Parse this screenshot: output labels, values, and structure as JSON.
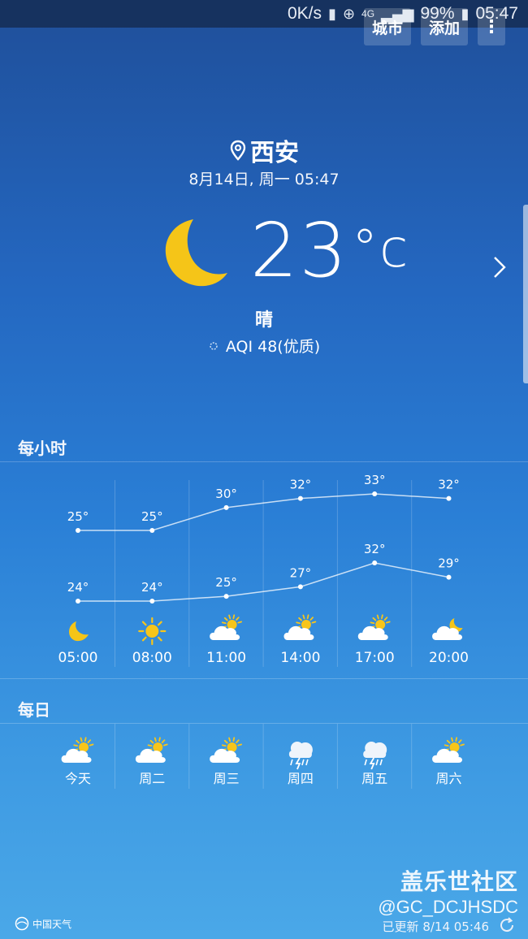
{
  "status_bar": {
    "net_speed": "0K/s",
    "network_type": "4G",
    "battery": "99%",
    "time": "05:47"
  },
  "actions": {
    "city_label": "城市",
    "add_label": "添加",
    "more_label": "⋮"
  },
  "current": {
    "city": "西安",
    "datetime": "8月14日, 周一 05:47",
    "temperature": "23",
    "unit": "°c",
    "condition": "晴",
    "aqi": "AQI 48(优质)",
    "icon": "moon-icon"
  },
  "hourly": {
    "title": "每小时",
    "items": [
      {
        "time": "05:00",
        "high": "25°",
        "low": "24°",
        "icon": "moon-icon"
      },
      {
        "time": "08:00",
        "high": "25°",
        "low": "24°",
        "icon": "sun-icon"
      },
      {
        "time": "11:00",
        "high": "30°",
        "low": "25°",
        "icon": "partly-cloudy-icon"
      },
      {
        "time": "14:00",
        "high": "32°",
        "low": "27°",
        "icon": "partly-cloudy-icon"
      },
      {
        "time": "17:00",
        "high": "33°",
        "low": "32°",
        "icon": "partly-cloudy-icon"
      },
      {
        "time": "20:00",
        "high": "32°",
        "low": "29°",
        "icon": "partly-cloudy-night-icon"
      }
    ],
    "high_values": [
      25,
      25,
      30,
      32,
      33,
      32
    ],
    "low_values": [
      24,
      24,
      25,
      27,
      32,
      29
    ]
  },
  "daily": {
    "title": "每日",
    "items": [
      {
        "day": "今天",
        "icon": "partly-cloudy-icon"
      },
      {
        "day": "周二",
        "icon": "partly-cloudy-icon"
      },
      {
        "day": "周三",
        "icon": "partly-cloudy-icon"
      },
      {
        "day": "周四",
        "icon": "thunderstorm-icon"
      },
      {
        "day": "周五",
        "icon": "thunderstorm-icon"
      },
      {
        "day": "周六",
        "icon": "partly-cloudy-icon"
      }
    ]
  },
  "watermark": {
    "main": "盖乐世社区",
    "sub": "@GC_DCJHSDC"
  },
  "footer": {
    "brand": "中国天气",
    "updated": "已更新 8/14 05:46"
  },
  "colors": {
    "moon": "#f5c518",
    "sun": "#f7c51a",
    "cloud": "#ffffff",
    "line": "#ffffff"
  }
}
